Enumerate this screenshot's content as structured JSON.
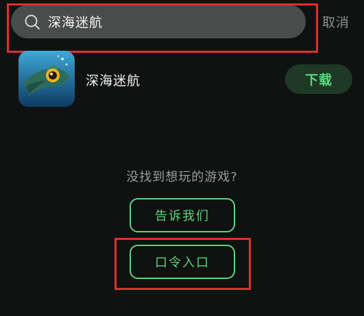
{
  "search": {
    "query": "深海迷航",
    "cancel_label": "取消",
    "icon": "search-icon"
  },
  "result": {
    "app_name": "深海迷航",
    "download_label": "下载",
    "icon": "subnautica-app-icon"
  },
  "empty_state": {
    "prompt": "没找到想玩的游戏?",
    "tell_us_label": "告诉我们",
    "code_entry_label": "口令入口"
  },
  "colors": {
    "accent_green": "#5fd67c",
    "highlight_red": "#e0302f",
    "background": "#101211",
    "search_bg": "#4a4c4b"
  }
}
